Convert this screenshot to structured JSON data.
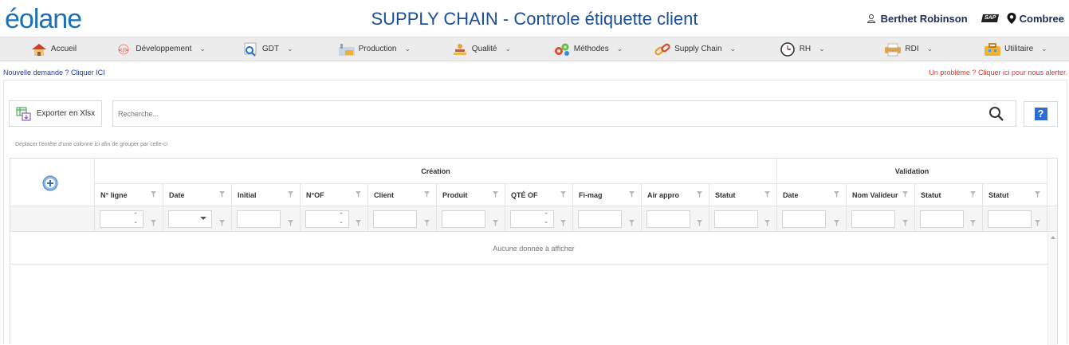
{
  "header": {
    "logo": "éolane",
    "title": "SUPPLY CHAIN - Controle étiquette client",
    "user_name": "Berthet Robinson",
    "sap_label": "SAP",
    "site": "Combree"
  },
  "nav": [
    {
      "label": "Accueil",
      "icon": "home-icon",
      "dropdown": false
    },
    {
      "label": "Développement",
      "icon": "code-icon",
      "dropdown": true
    },
    {
      "label": "GDT",
      "icon": "search-doc-icon",
      "dropdown": true
    },
    {
      "label": "Production",
      "icon": "factory-icon",
      "dropdown": true
    },
    {
      "label": "Qualité",
      "icon": "quality-icon",
      "dropdown": true
    },
    {
      "label": "Méthodes",
      "icon": "gears-icon",
      "dropdown": true
    },
    {
      "label": "Supply Chain",
      "icon": "chain-icon",
      "dropdown": true
    },
    {
      "label": "RH",
      "icon": "clock-icon",
      "dropdown": true
    },
    {
      "label": "RDI",
      "icon": "printer-icon",
      "dropdown": true
    },
    {
      "label": "Utilitaire",
      "icon": "toolbox-icon",
      "dropdown": true
    }
  ],
  "links": {
    "new_request": "Nouvelle demande ? Cliquer ICI",
    "report_problem": "Un problème ? Cliquer ici pour nous alerter."
  },
  "toolbar": {
    "export_label": "Exporter en Xlsx",
    "search_placeholder": "Recherche...",
    "help_label": "?"
  },
  "grid": {
    "group_hint": "Déplacer l'entête d'une colonne ici afin de grouper par celle-ci",
    "band_creation": "Création",
    "band_validation": "Validation",
    "columns": [
      "N° ligne",
      "Date",
      "Initial",
      "N°OF",
      "Client",
      "Produit",
      "QTÉ OF",
      "Fi-mag",
      "Air appro",
      "Statut",
      "Date",
      "Nom Valideur",
      "Statut",
      "Statut"
    ],
    "empty_text": "Aucune donnée à afficher"
  },
  "colors": {
    "title": "#1b4f9c",
    "logo": "#1f6fb7",
    "nav_bg": "#ececec",
    "link_blue": "#1a3fc2",
    "link_red": "#e03a2e",
    "help_blue": "#2a6ed6"
  }
}
